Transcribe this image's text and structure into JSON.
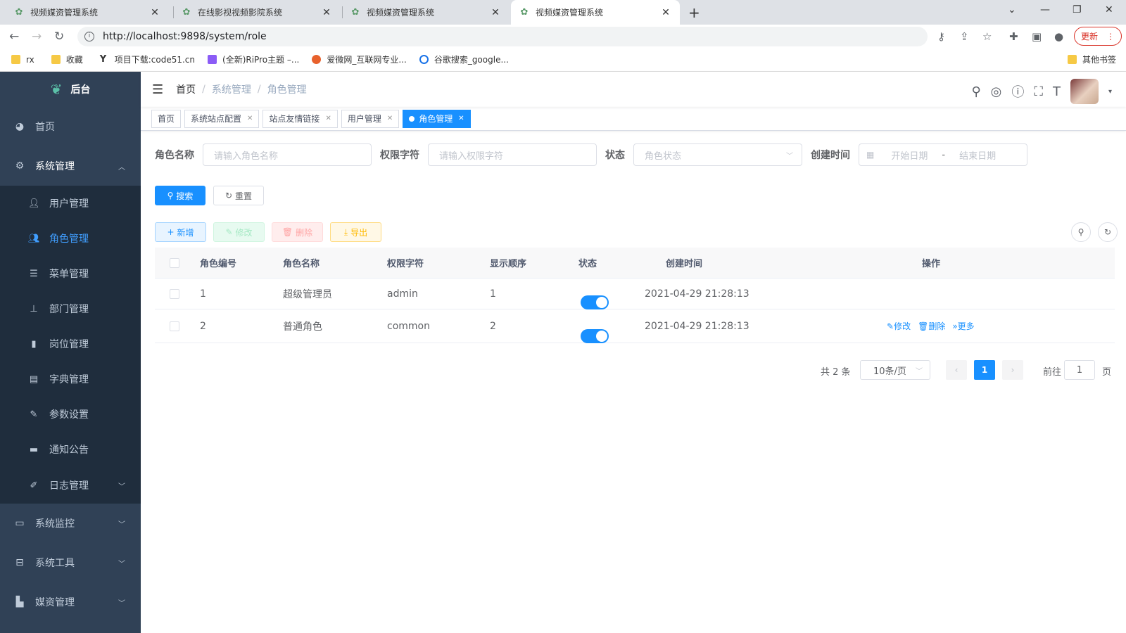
{
  "browser": {
    "tabs": [
      {
        "title": "视频媒资管理系统"
      },
      {
        "title": "在线影视视频影院系统"
      },
      {
        "title": "视频媒资管理系统"
      },
      {
        "title": "视频媒资管理系统"
      }
    ],
    "url": "http://localhost:9898/system/role",
    "update_label": "更新",
    "bookmarks": [
      "rx",
      "收藏",
      "项目下载:code51.cn",
      "(全新)RiPro主题 –...",
      "爱微网_互联网专业...",
      "谷歌搜索_google..."
    ],
    "other_bookmarks": "其他书签"
  },
  "sidebar": {
    "logo_title": "后台",
    "items": [
      {
        "label": "首页",
        "icon": "dashboard-icon"
      },
      {
        "label": "系统管理",
        "icon": "gear-icon"
      },
      {
        "label": "系统监控",
        "icon": "monitor-icon"
      },
      {
        "label": "系统工具",
        "icon": "toolbox-icon"
      },
      {
        "label": "媒资管理",
        "icon": "media-icon"
      }
    ],
    "sub_items": [
      {
        "label": "用户管理",
        "icon": "user-icon"
      },
      {
        "label": "角色管理",
        "icon": "peoples-icon"
      },
      {
        "label": "菜单管理",
        "icon": "tree-table-icon"
      },
      {
        "label": "部门管理",
        "icon": "tree-icon"
      },
      {
        "label": "岗位管理",
        "icon": "post-icon"
      },
      {
        "label": "字典管理",
        "icon": "dict-icon"
      },
      {
        "label": "参数设置",
        "icon": "edit-icon"
      },
      {
        "label": "通知公告",
        "icon": "message-icon"
      },
      {
        "label": "日志管理",
        "icon": "log-icon"
      }
    ]
  },
  "breadcrumb": [
    "首页",
    "系统管理",
    "角色管理"
  ],
  "tags": [
    "首页",
    "系统站点配置",
    "站点友情链接",
    "用户管理",
    "角色管理"
  ],
  "search_form": {
    "role_name_label": "角色名称",
    "role_name_placeholder": "请输入角色名称",
    "perm_label": "权限字符",
    "perm_placeholder": "请输入权限字符",
    "status_label": "状态",
    "status_placeholder": "角色状态",
    "created_label": "创建时间",
    "start_placeholder": "开始日期",
    "range_sep": "-",
    "end_placeholder": "结束日期",
    "search_btn": "搜索",
    "reset_btn": "重置"
  },
  "toolbar": {
    "add": "新增",
    "edit": "修改",
    "delete": "删除",
    "export": "导出"
  },
  "table": {
    "columns": [
      "角色编号",
      "角色名称",
      "权限字符",
      "显示顺序",
      "状态",
      "创建时间",
      "操作"
    ],
    "rows": [
      {
        "id": "1",
        "name": "超级管理员",
        "key": "admin",
        "sort": "1",
        "status": true,
        "created": "2021-04-29 21:28:13"
      },
      {
        "id": "2",
        "name": "普通角色",
        "key": "common",
        "sort": "2",
        "status": true,
        "created": "2021-04-29 21:28:13"
      }
    ],
    "ops": {
      "edit": "修改",
      "delete": "删除",
      "more": "更多"
    }
  },
  "pagination": {
    "total": "共 2 条",
    "page_size": "10条/页",
    "current": "1",
    "goto_label": "前往",
    "goto_value": "1",
    "page_suffix": "页"
  },
  "colors": {
    "primary": "#1890ff",
    "sidebar": "#304156",
    "submenu": "#1f2d3d"
  }
}
